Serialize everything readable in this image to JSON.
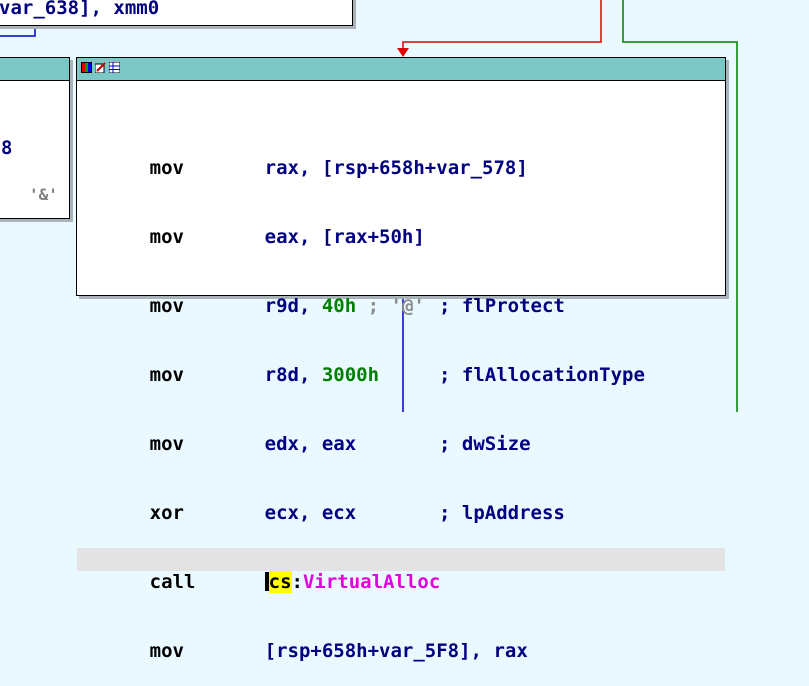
{
  "top_node": {
    "text": "var_638], xmm0"
  },
  "left_node": {
    "fragments": [
      "8",
      "'&'"
    ]
  },
  "main_node": {
    "toolbar_icons": [
      "graph-color-icon",
      "edit-icon",
      "grid-icon"
    ],
    "lines": [
      {
        "mnemonic": "mov",
        "op1": "rax,",
        "op2": "[rsp+658h+var_578]"
      },
      {
        "mnemonic": "mov",
        "op1": "eax,",
        "op2": "[rax+50h]"
      },
      {
        "mnemonic": "mov",
        "op1": "r9d,",
        "num": "40h",
        "sep": " ; '@'",
        "comment": "; flProtect"
      },
      {
        "mnemonic": "mov",
        "op1": "r8d,",
        "num": "3000h",
        "comment": "; flAllocationType"
      },
      {
        "mnemonic": "mov",
        "op1": "edx,",
        "op2": "eax",
        "comment": "; dwSize"
      },
      {
        "mnemonic": "xor",
        "op1": "ecx,",
        "op2": "ecx",
        "comment": "; lpAddress"
      },
      {
        "mnemonic": "call",
        "seg": "cs",
        "colon": ":",
        "sym": "VirtualAlloc"
      },
      {
        "mnemonic": "mov",
        "op1": "[rsp+658h+var_5F8],",
        "op2": "rax"
      }
    ]
  },
  "colors": {
    "background": "#eaf9ff",
    "title_bar": "#7cc8c6",
    "edge_red": "#e00000",
    "edge_green": "#008000",
    "edge_blue": "#0000c0"
  }
}
